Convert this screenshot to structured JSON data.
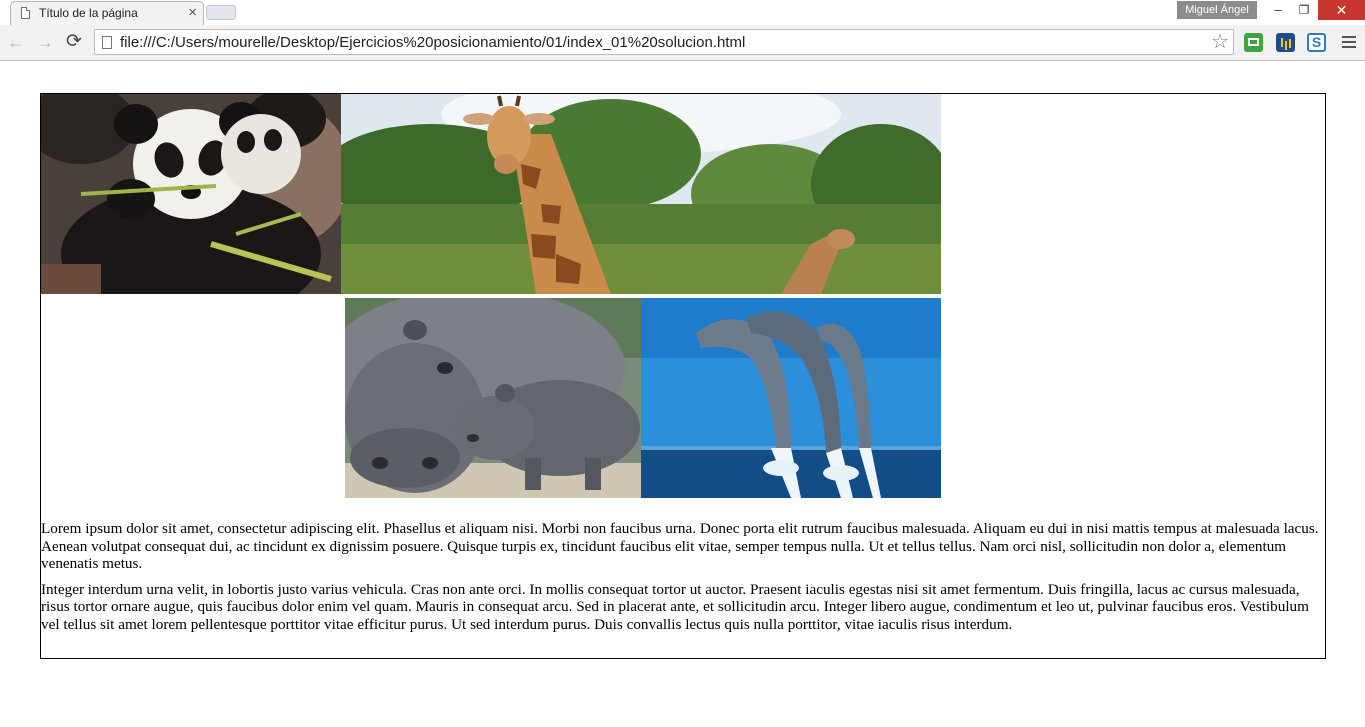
{
  "browser": {
    "tab_title": "Título de la página",
    "tab_close": "×",
    "user_name": "Miguel Ángel",
    "url": "file:///C:/Users/mourelle/Desktop/Ejercicios%20posicionamiento/01/index_01%20solucion.html",
    "controls": {
      "minimize": "–",
      "maximize": "❐",
      "close": "✕"
    },
    "nav": {
      "back": "←",
      "forward": "→",
      "reload": "⟳",
      "star": "☆"
    },
    "extensions": [
      "print-friendly-icon",
      "chart-icon",
      "s-logo-icon"
    ],
    "extension_s_letter": "S",
    "colors": {
      "close_button": "#c7372f",
      "user_badge": "#8c8c8c"
    }
  },
  "page": {
    "images": [
      "panda-photo",
      "giraffe-photo",
      "hippo-photo",
      "dolphins-photo"
    ],
    "paragraphs": [
      "Lorem ipsum dolor sit amet, consectetur adipiscing elit. Phasellus et aliquam nisi. Morbi non faucibus urna. Donec porta elit rutrum faucibus malesuada. Aliquam eu dui in nisi mattis tempus at malesuada lacus. Aenean volutpat consequat dui, ac tincidunt ex dignissim posuere. Quisque turpis ex, tincidunt faucibus elit vitae, semper tempus nulla. Ut et tellus tellus. Nam orci nisl, sollicitudin non dolor a, elementum venenatis metus.",
      "Integer interdum urna velit, in lobortis justo varius vehicula. Cras non ante orci. In mollis consequat tortor ut auctor. Praesent iaculis egestas nisi sit amet fermentum. Duis fringilla, lacus ac cursus malesuada, risus tortor ornare augue, quis faucibus dolor enim vel quam. Mauris in consequat arcu. Sed in placerat ante, et sollicitudin arcu. Integer libero augue, condimentum et leo ut, pulvinar faucibus eros. Vestibulum vel tellus sit amet lorem pellentesque porttitor vitae efficitur purus. Ut sed interdum purus. Duis convallis lectus quis nulla porttitor, vitae iaculis risus interdum."
    ]
  }
}
